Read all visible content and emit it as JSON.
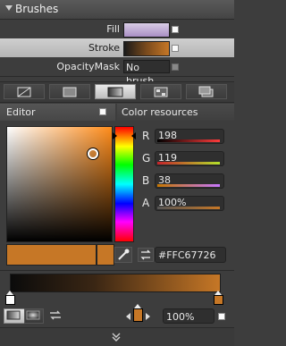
{
  "header": {
    "title": "Brushes"
  },
  "brushes": {
    "fill_label": "Fill",
    "stroke_label": "Stroke",
    "opacity_mask_label": "OpacityMask",
    "opacity_mask_value": "No brush"
  },
  "editor": {
    "label": "Editor"
  },
  "color_resources": {
    "label": "Color resources"
  },
  "channels": {
    "r_label": "R",
    "r_value": "198",
    "g_label": "G",
    "g_value": "119",
    "b_label": "B",
    "b_value": "38",
    "a_label": "A",
    "a_value": "100%"
  },
  "hex_value": "#FFC67726",
  "gradient": {
    "stop_opacity": "100%"
  },
  "colors": {
    "accent": "#c67726",
    "fill_swatch_top": "#c8b6dc",
    "stroke_start": "#1a1a1a",
    "stroke_end": "#c67726"
  },
  "icons": {
    "eyedropper": "eyedropper-icon",
    "gradient_reverse": "reverse-icon"
  }
}
